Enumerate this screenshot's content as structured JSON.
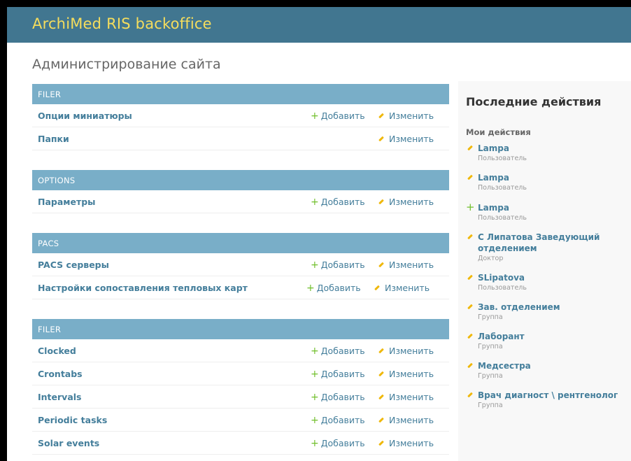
{
  "header": {
    "brand": "ArchiMed RIS backoffice"
  },
  "page_title": "Администрирование сайта",
  "actions": {
    "add_label": "Добавить",
    "change_label": "Изменить"
  },
  "modules": [
    {
      "caption": "FILER",
      "rows": [
        {
          "label": "Опции миниатюры",
          "add": true
        },
        {
          "label": "Папки",
          "add": false
        }
      ]
    },
    {
      "caption": "OPTIONS",
      "rows": [
        {
          "label": "Параметры",
          "add": true
        }
      ]
    },
    {
      "caption": "PACS",
      "rows": [
        {
          "label": "PACS серверы",
          "add": true
        },
        {
          "label": "Настройки сопоставления тепловых карт",
          "add": true
        }
      ]
    },
    {
      "caption": "FILER",
      "rows": [
        {
          "label": "Clocked",
          "add": true
        },
        {
          "label": "Crontabs",
          "add": true
        },
        {
          "label": "Intervals",
          "add": true
        },
        {
          "label": "Periodic tasks",
          "add": true
        },
        {
          "label": "Solar events",
          "add": true
        }
      ]
    }
  ],
  "sidebar": {
    "title": "Последние действия",
    "subtitle": "Мои действия",
    "items": [
      {
        "icon": "edit-icon",
        "name": "Lampa",
        "type": "Пользователь"
      },
      {
        "icon": "edit-icon",
        "name": "Lampa",
        "type": "Пользователь"
      },
      {
        "icon": "add-icon",
        "name": "Lampa",
        "type": "Пользователь"
      },
      {
        "icon": "edit-icon",
        "name": "С Липатова Заведующий отделением",
        "type": "Доктор"
      },
      {
        "icon": "edit-icon",
        "name": "SLipatova",
        "type": "Пользователь"
      },
      {
        "icon": "edit-icon",
        "name": "Зав. отделением",
        "type": "Группа"
      },
      {
        "icon": "edit-icon",
        "name": "Лаборант",
        "type": "Группа"
      },
      {
        "icon": "edit-icon",
        "name": "Медсестра",
        "type": "Группа"
      },
      {
        "icon": "edit-icon",
        "name": "Врач диагност \\ рентгенолог",
        "type": "Группа"
      }
    ]
  },
  "colors": {
    "header": "#417690",
    "brand": "#f5dd5d",
    "caption": "#79aec8",
    "link": "#447e9b",
    "add": "#70bf2b",
    "edit": "#efb80b"
  }
}
